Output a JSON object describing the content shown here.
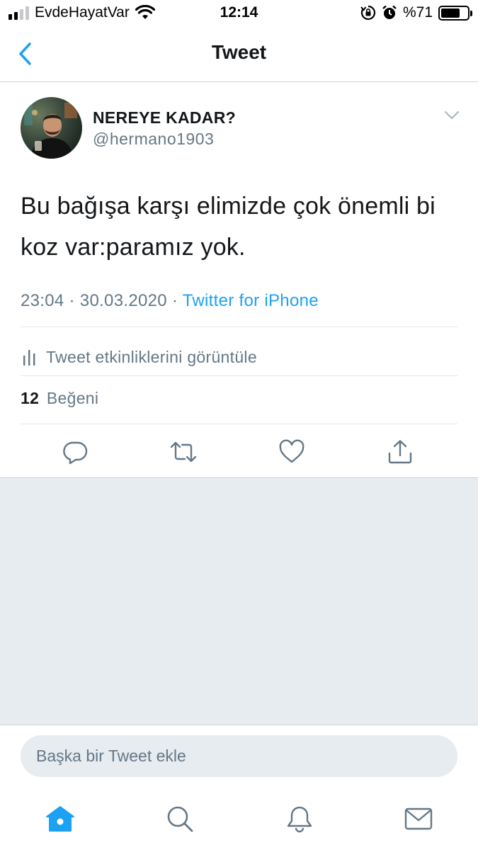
{
  "status_bar": {
    "carrier": "EvdeHayatVar",
    "time": "12:14",
    "battery_percent": "%71",
    "battery_level": 0.71,
    "signal_bars_active": 2,
    "signal_bars_total": 4
  },
  "nav": {
    "title": "Tweet"
  },
  "tweet": {
    "display_name": "NEREYE KADAR?",
    "handle": "@hermano1903",
    "text": "Bu bağışa karşı elimizde çok önemli bi koz var:paramız yok.",
    "time": "23:04",
    "date": "30.03.2020",
    "separator": "·",
    "source": "Twitter for iPhone",
    "activity_label": "Tweet etkinliklerini görüntüle",
    "likes_count": "12",
    "likes_label": "Beğeni"
  },
  "reply": {
    "placeholder": "Başka bir Tweet ekle"
  },
  "colors": {
    "accent": "#1da1f2",
    "secondary_text": "#657786",
    "primary_text": "#14171a",
    "background_gray": "#e6ecf0"
  },
  "icons": {
    "back": "chevron-left-icon",
    "more": "chevron-down-icon",
    "analytics": "bar-chart-icon",
    "reply": "reply-icon",
    "retweet": "retweet-icon",
    "like": "heart-icon",
    "share": "share-icon",
    "home": "home-icon",
    "search": "search-icon",
    "notifications": "bell-icon",
    "messages": "mail-icon"
  }
}
